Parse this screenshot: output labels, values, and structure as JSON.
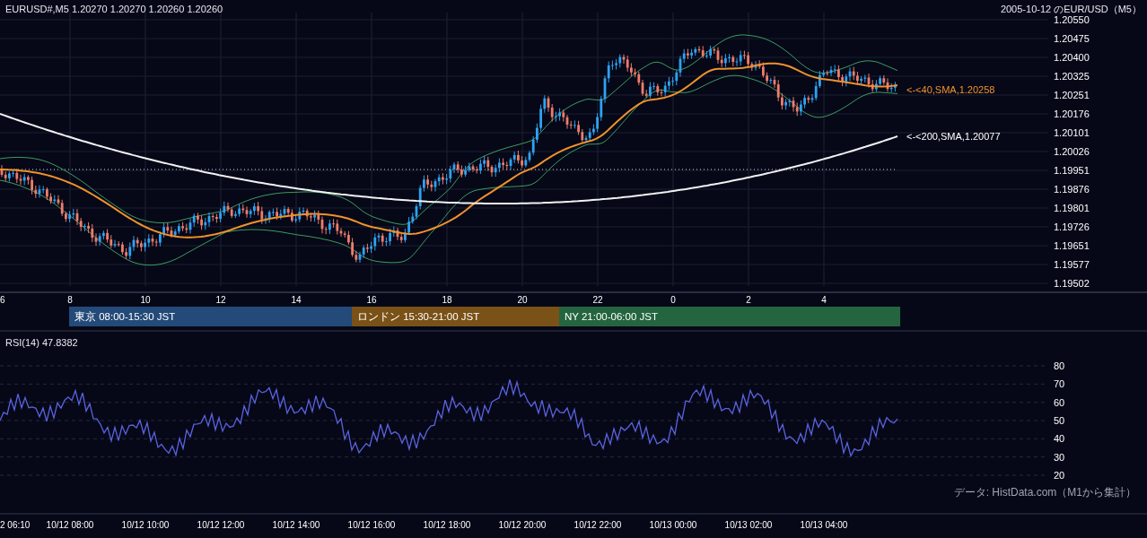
{
  "header": {
    "quote": "EURUSD#,M5 1.20270 1.20270 1.20260 1.20260",
    "title": "2005-10-12 のEUR/USD（M5）"
  },
  "price_axis": [
    "1.20550",
    "1.20475",
    "1.20400",
    "1.20325",
    "1.20251",
    "1.20176",
    "1.20101",
    "1.20026",
    "1.19951",
    "1.19876",
    "1.19801",
    "1.19726",
    "1.19651",
    "1.19577",
    "1.19502"
  ],
  "ma_labels": [
    {
      "text": "<-<40,SMA,1.20258",
      "color": "#f0922a"
    },
    {
      "text": "<-<200,SMA,1.20077",
      "color": "#ffffff"
    }
  ],
  "hour_axis": [
    "6",
    "8",
    "10",
    "12",
    "14",
    "16",
    "18",
    "20",
    "22",
    "0",
    "2",
    "4"
  ],
  "sessions": [
    {
      "label": "東京 08:00-15:30 JST",
      "color": "#234a78"
    },
    {
      "label": "ロンドン 15:30-21:00 JST",
      "color": "#7a5116"
    },
    {
      "label": "NY 21:00-06:00 JST",
      "color": "#24653f"
    }
  ],
  "rsi": {
    "label": "RSI(14) 47.8382",
    "axis": [
      "80",
      "70",
      "60",
      "50",
      "40",
      "30",
      "20"
    ]
  },
  "credit": "データ: HistData.com（M1から集計）",
  "time_axis": [
    "2 06:10",
    "10/12 08:00",
    "10/12 10:00",
    "10/12 12:00",
    "10/12 14:00",
    "10/12 16:00",
    "10/12 18:00",
    "10/12 20:00",
    "10/12 22:00",
    "10/13 00:00",
    "10/13 02:00",
    "10/13 04:00"
  ]
}
